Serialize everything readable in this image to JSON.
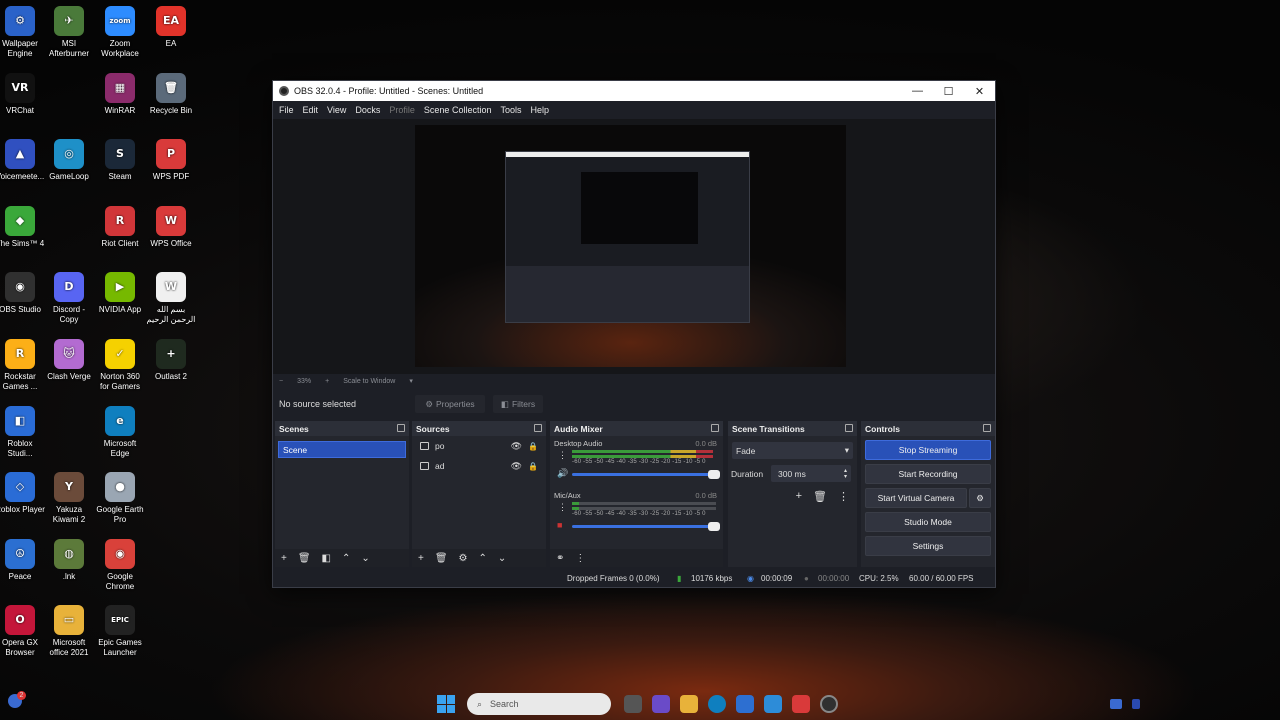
{
  "desktop": {
    "icons": [
      {
        "label": "Wallpaper Engine",
        "color": "#2a62c9",
        "glyph": "⚙"
      },
      {
        "label": "MSI Afterburner",
        "color": "#4a7a3a",
        "glyph": "✈"
      },
      {
        "label": "Zoom Workplace",
        "color": "#2d8cff",
        "glyph": "zoom"
      },
      {
        "label": "EA",
        "color": "#e2332a",
        "glyph": "EA"
      },
      {
        "label": "VRChat",
        "color": "#111111",
        "glyph": "VR"
      },
      {
        "label": "WinRAR",
        "color": "#8b2b6b",
        "glyph": "▦"
      },
      {
        "label": "Recycle Bin",
        "color": "#5b6a7a",
        "glyph": "🗑"
      },
      {
        "label": "Voicemeete...",
        "color": "#3050c0",
        "glyph": "▲"
      },
      {
        "label": "GameLoop",
        "color": "#1e90c8",
        "glyph": "◎"
      },
      {
        "label": "Steam",
        "color": "#1b2838",
        "glyph": "S"
      },
      {
        "label": "WPS PDF",
        "color": "#d93a3a",
        "glyph": "P"
      },
      {
        "label": "The Sims™ 4",
        "color": "#3aa83a",
        "glyph": "◆"
      },
      {
        "label": "Riot Client",
        "color": "#d13639",
        "glyph": "R"
      },
      {
        "label": "WPS Office",
        "color": "#d93a3a",
        "glyph": "W"
      },
      {
        "label": "OBS Studio",
        "color": "#303030",
        "glyph": "◉"
      },
      {
        "label": "Discord - Copy",
        "color": "#5865f2",
        "glyph": "D"
      },
      {
        "label": "NVIDIA App",
        "color": "#76b900",
        "glyph": "▶"
      },
      {
        "label": "بسم الله الرحمن الرحيم",
        "color": "#f0f0f0",
        "glyph": "W"
      },
      {
        "label": "Rockstar Games ...",
        "color": "#fcaf17",
        "glyph": "R"
      },
      {
        "label": "Clash Verge",
        "color": "#b36bd1",
        "glyph": "🐱"
      },
      {
        "label": "Norton 360 for Gamers",
        "color": "#f5d100",
        "glyph": "✓"
      },
      {
        "label": "Outlast 2",
        "color": "#1f2a1f",
        "glyph": "+"
      },
      {
        "label": "Roblox Studi...",
        "color": "#2a6cd6",
        "glyph": "◧"
      },
      {
        "label": "Microsoft Edge",
        "color": "#0f7fbf",
        "glyph": "e"
      },
      {
        "label": "Roblox Player",
        "color": "#2a6cd6",
        "glyph": "◇"
      },
      {
        "label": "Yakuza Kiwami 2",
        "color": "#6b4b3a",
        "glyph": "Y"
      },
      {
        "label": "Google Earth Pro",
        "color": "#9aa6b3",
        "glyph": "●"
      },
      {
        "label": "Peace",
        "color": "#2b6fd1",
        "glyph": "☮"
      },
      {
        "label": ".lnk",
        "color": "#5c7a3a",
        "glyph": "◍"
      },
      {
        "label": "Google Chrome",
        "color": "#d9413a",
        "glyph": "◉"
      },
      {
        "label": "Opera GX Browser",
        "color": "#c4163a",
        "glyph": "O"
      },
      {
        "label": "Microsoft office 2021",
        "color": "#e8b23a",
        "glyph": "▭"
      },
      {
        "label": "Epic Games Launcher",
        "color": "#222222",
        "glyph": "EPIC"
      }
    ]
  },
  "window": {
    "title": "OBS 32.0.4 - Profile: Untitled - Scenes: Untitled",
    "controls": {
      "minimize": "—",
      "maximize": "☐",
      "close": "✕"
    }
  },
  "menu": {
    "file": "File",
    "edit": "Edit",
    "view": "View",
    "docks": "Docks",
    "profile": "Profile",
    "scene_collection": "Scene Collection",
    "tools": "Tools",
    "help": "Help"
  },
  "zoom": {
    "minus": "−",
    "level": "33%",
    "plus": "+",
    "scale": "Scale to Window",
    "dropdown": "▾"
  },
  "source_bar": {
    "status": "No source selected",
    "properties": "Properties",
    "filters": "Filters"
  },
  "scenes": {
    "title": "Scenes",
    "items": [
      "Scene"
    ]
  },
  "sources": {
    "title": "Sources",
    "items": [
      {
        "name": "po"
      },
      {
        "name": "ad"
      }
    ]
  },
  "mixer": {
    "title": "Audio Mixer",
    "scale": "-60 -55 -50 -45 -40 -35 -30 -25 -20 -15 -10 -5 0",
    "channels": [
      {
        "name": "Desktop Audio",
        "db": "0.0 dB",
        "level": 0.98
      },
      {
        "name": "Mic/Aux",
        "db": "0.0 dB",
        "level": 0.05
      }
    ]
  },
  "transitions": {
    "title": "Scene Transitions",
    "selected": "Fade",
    "duration_label": "Duration",
    "duration_value": "300 ms"
  },
  "controls": {
    "title": "Controls",
    "stop_streaming": "Stop Streaming",
    "start_recording": "Start Recording",
    "start_virtual_camera": "Start Virtual Camera",
    "studio_mode": "Studio Mode",
    "settings": "Settings",
    "accent": "#2951b8"
  },
  "status": {
    "dropped": "Dropped Frames 0 (0.0%)",
    "bitrate": "10176 kbps",
    "stream_time": "00:00:09",
    "record_time": "00:00:00",
    "cpu": "CPU: 2.5%",
    "fps": "60.00 / 60.00 FPS"
  },
  "taskbar": {
    "search_placeholder": "Search",
    "notification_count": "2"
  }
}
